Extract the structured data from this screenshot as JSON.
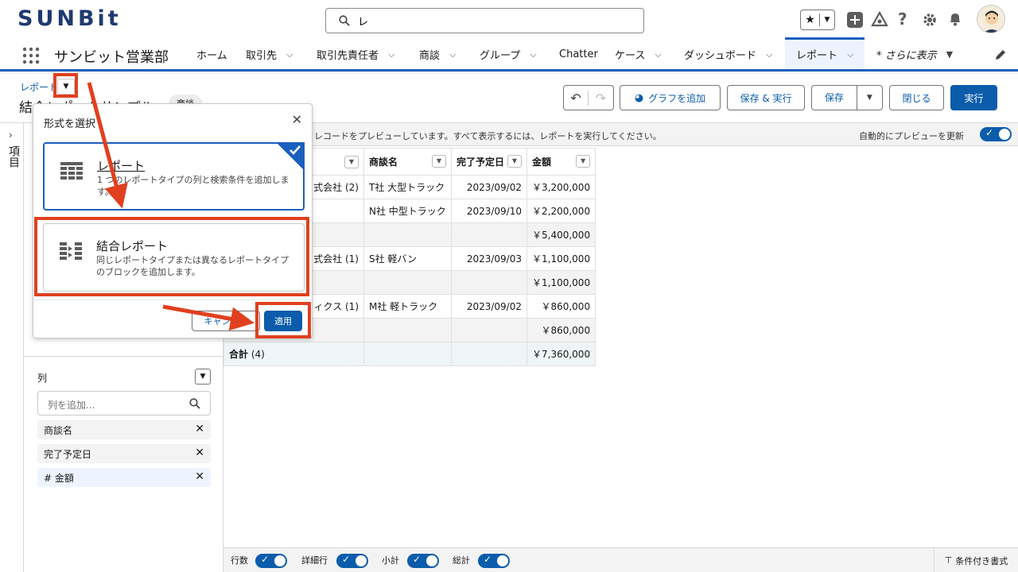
{
  "topbar": {
    "logo": "SUNBit",
    "search_value": "レ",
    "icons": [
      "favorites-icon",
      "add-icon",
      "trailhead-icon",
      "help-icon",
      "gear-icon",
      "bell-icon",
      "avatar"
    ]
  },
  "nav": {
    "app_name": "サンビット営業部",
    "items": [
      {
        "label": "ホーム",
        "chevron": false
      },
      {
        "label": "取引先",
        "chevron": true
      },
      {
        "label": "取引先責任者",
        "chevron": true
      },
      {
        "label": "商談",
        "chevron": true
      },
      {
        "label": "グループ",
        "chevron": true
      },
      {
        "label": "Chatter",
        "chevron": false
      },
      {
        "label": "ケース",
        "chevron": true
      },
      {
        "label": "ダッシュボード",
        "chevron": true
      },
      {
        "label": "レポート",
        "chevron": true
      },
      {
        "label": "* さらに表示",
        "chevron": true
      }
    ]
  },
  "report_header": {
    "breadcrumb": "レポート",
    "title": "結合レポートサンプル",
    "pencil": "✎",
    "tag": "商談",
    "buttons": {
      "add_chart": "グラフを追加",
      "save_run": "保存 & 実行",
      "save": "保存",
      "close": "閉じる",
      "run": "実行"
    }
  },
  "rail": {
    "label": "項目"
  },
  "left_panel": {
    "columns_heading": "列",
    "search_placeholder": "列を追加...",
    "columns": [
      {
        "label": "商談名",
        "type": "text"
      },
      {
        "label": "完了予定日",
        "type": "date"
      },
      {
        "label": "# 金額",
        "type": "number"
      }
    ]
  },
  "preview": {
    "message": "レコードをプレビューしています。すべて表示するには、レポートを実行してください。",
    "auto_update_label": "自動的にプレビューを更新"
  },
  "table": {
    "headers": [
      "",
      "商談名",
      "完了予定日",
      "金額"
    ],
    "rows": [
      {
        "group": "式会社 (2)",
        "name": "T社 大型トラック",
        "date": "2023/09/02",
        "amount": "￥3,200,000",
        "kind": "detail"
      },
      {
        "group": "",
        "name": "N社 中型トラック",
        "date": "2023/09/10",
        "amount": "￥2,200,000",
        "kind": "detail"
      },
      {
        "group": "",
        "name": "",
        "date": "",
        "amount": "￥5,400,000",
        "kind": "subtotal"
      },
      {
        "group": "式会社 (1)",
        "name": "S社 軽バン",
        "date": "2023/09/03",
        "amount": "￥1,100,000",
        "kind": "detail"
      },
      {
        "group": "",
        "name": "",
        "date": "",
        "amount": "￥1,100,000",
        "kind": "subtotal"
      },
      {
        "group": "ィクス (1)",
        "name": "M社 軽トラック",
        "date": "2023/09/02",
        "amount": "￥860,000",
        "kind": "detail"
      },
      {
        "group": "",
        "name": "",
        "date": "",
        "amount": "￥860,000",
        "kind": "subtotal"
      }
    ],
    "total": {
      "label": "合計",
      "count": "(4)",
      "amount": "￥7,360,000"
    }
  },
  "bottombar": {
    "row_count": "行数",
    "detail_rows": "詳細行",
    "subtotals": "小計",
    "grand_total": "総計",
    "conditional_format": "条件付き書式"
  },
  "modal": {
    "title": "形式を選択",
    "options": [
      {
        "title": "レポート",
        "desc": "1 つのレポートタイプの列と検索条件を追加します。",
        "selected": true
      },
      {
        "title": "結合レポート",
        "desc": "同じレポートタイプまたは異なるレポートタイプのブロックを追加します。",
        "selected": false
      }
    ],
    "cancel": "キャンセル",
    "apply": "適用"
  },
  "colors": {
    "brand_blue": "#0b5cab",
    "nav_active": "#1b5fbf",
    "annotation_red": "#e0401f"
  }
}
